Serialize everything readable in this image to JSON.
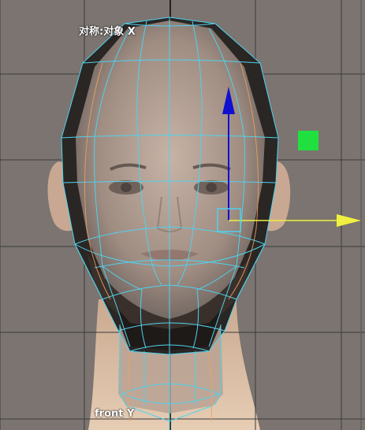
{
  "viewport": {
    "symmetry_label": "对称:对象 X",
    "camera_label": "front Y"
  },
  "colors": {
    "background": "#7b7470",
    "grid_line": "#3b3b3b",
    "wire": "#4fd2ee",
    "wire_secondary": "#f0a060",
    "move_y_axis": "#1010d0",
    "move_x_axis": "#f0f040",
    "selection_handle": "#20e040",
    "mesh_shell": "#2a2624"
  },
  "icons": {
    "move_manipulator": "move-manipulator-icon",
    "y_axis_arrow": "up-arrow-icon",
    "x_axis_arrow": "right-arrow-icon",
    "center_handle": "square-handle-icon"
  }
}
